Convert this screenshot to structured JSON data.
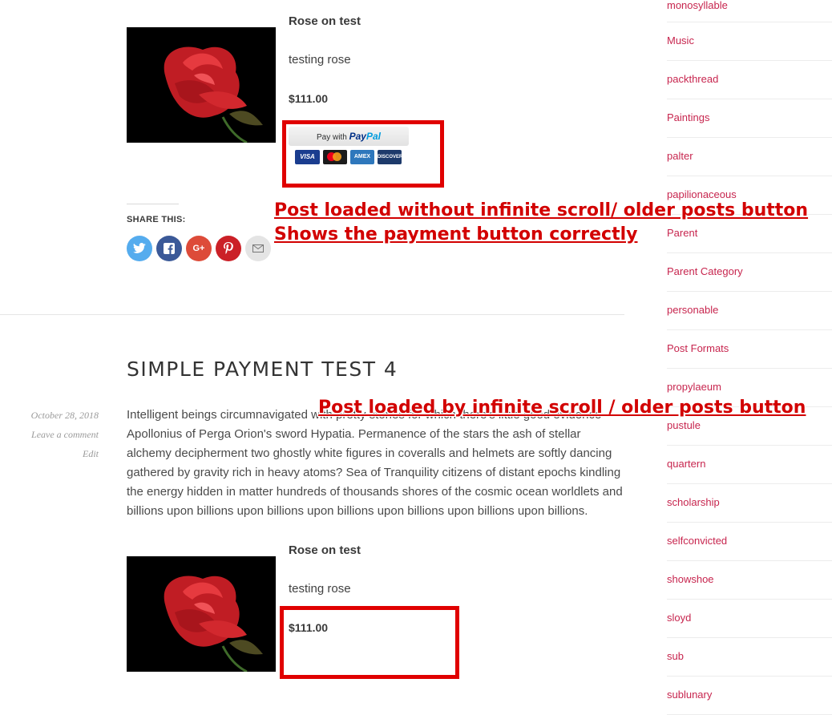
{
  "post1": {
    "product_name": "Rose on test",
    "product_desc": "testing rose",
    "price": "$111.00",
    "paypal": {
      "prefix": "Pay with",
      "pay": "Pay",
      "pal": "Pal"
    },
    "cards": [
      "VISA",
      "mastercard",
      "AMEX",
      "DISCOVER"
    ],
    "share_label": "SHARE THIS:",
    "share_buttons": [
      "twitter-icon",
      "facebook-icon",
      "google-plus-icon",
      "pinterest-icon",
      "email-icon"
    ]
  },
  "annotation1": {
    "line1": "Post loaded without infinite scroll/ older posts button",
    "line2": "Shows the payment button correctly"
  },
  "annotation2": "Post loaded by infinite scroll / older posts button",
  "post2": {
    "title": "SIMPLE PAYMENT TEST 4",
    "date": "October 28, 2018",
    "comment_link": "Leave a comment",
    "edit_link": "Edit",
    "body": "Intelligent beings circumnavigated with pretty stories for which there's little good evidence Apollonius of Perga Orion's sword Hypatia. Permanence of the stars the ash of stellar alchemy decipherment two ghostly white figures in coveralls and helmets are softly dancing gathered by gravity rich in heavy atoms? Sea of Tranquility citizens of distant epochs kindling the energy hidden in matter hundreds of thousands shores of the cosmic ocean worldlets and billions upon billions upon billions upon billions upon billions upon billions upon billions.",
    "product_name": "Rose on test",
    "product_desc": "testing rose",
    "price": "$111.00"
  },
  "sidebar": {
    "items": [
      {
        "label": "monosyllable"
      },
      {
        "label": "Music"
      },
      {
        "label": "packthread"
      },
      {
        "label": "Paintings"
      },
      {
        "label": "palter"
      },
      {
        "label": "papilionaceous"
      },
      {
        "label": "Parent"
      },
      {
        "label": "Parent Category"
      },
      {
        "label": "personable"
      },
      {
        "label": "Post Formats"
      },
      {
        "label": "propylaeum"
      },
      {
        "label": "pustule"
      },
      {
        "label": "quartern"
      },
      {
        "label": "scholarship"
      },
      {
        "label": "selfconvicted"
      },
      {
        "label": "showshoe"
      },
      {
        "label": "sloyd"
      },
      {
        "label": "sub"
      },
      {
        "label": "sublunary"
      }
    ]
  },
  "colors": {
    "annotation": "#d20000",
    "link": "#c7254e",
    "highlight_box": "#e00000"
  }
}
